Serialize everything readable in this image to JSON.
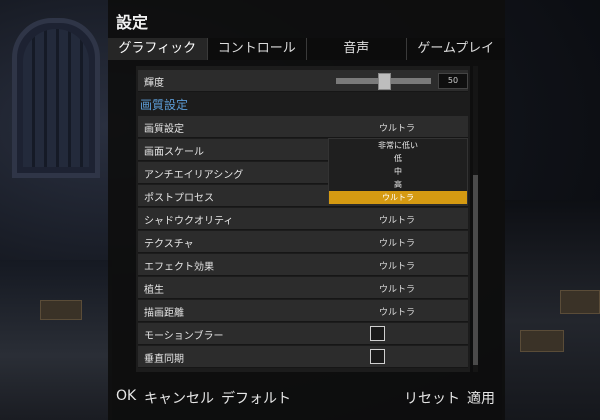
{
  "window": {
    "title": "設定"
  },
  "tabs": [
    {
      "label": "グラフィック",
      "active": true
    },
    {
      "label": "コントロール",
      "active": false
    },
    {
      "label": "音声",
      "active": false
    },
    {
      "label": "ゲームプレイ",
      "active": false
    }
  ],
  "brightness": {
    "label": "輝度",
    "value": "50",
    "level_percent": 50
  },
  "section_title": "画質設定",
  "settings": [
    {
      "label": "画質設定",
      "value": "ウルトラ"
    },
    {
      "label": "画面スケール",
      "value": ""
    },
    {
      "label": "アンチエイリアシング",
      "value": ""
    },
    {
      "label": "ポストプロセス",
      "value": ""
    },
    {
      "label": "シャドウクオリティ",
      "value": "ウルトラ"
    },
    {
      "label": "テクスチャ",
      "value": "ウルトラ"
    },
    {
      "label": "エフェクト効果",
      "value": "ウルトラ"
    },
    {
      "label": "植生",
      "value": "ウルトラ"
    },
    {
      "label": "描画距離",
      "value": "ウルトラ"
    },
    {
      "label": "モーションブラー",
      "value": ""
    },
    {
      "label": "垂直同期",
      "value": ""
    }
  ],
  "dropdown": {
    "options": [
      "非常に低い",
      "低",
      "中",
      "高",
      "ウルトラ"
    ],
    "selected": "ウルトラ"
  },
  "footer": {
    "ok": "OK",
    "cancel": "キャンセル",
    "default": "デフォルト",
    "reset": "リセット",
    "apply": "適用"
  },
  "colors": {
    "accent": "#d59a12",
    "section": "#5b9bd5",
    "panel": "#0e0e0e"
  }
}
